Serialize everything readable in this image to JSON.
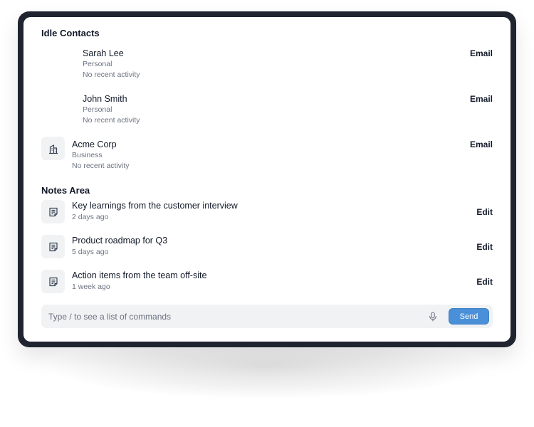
{
  "idle_contacts": {
    "title": "Idle Contacts",
    "items": [
      {
        "name": "Sarah Lee",
        "type": "Personal",
        "activity": "No recent activity",
        "action": "Email",
        "icon": ""
      },
      {
        "name": "John Smith",
        "type": "Personal",
        "activity": "No recent activity",
        "action": "Email",
        "icon": ""
      },
      {
        "name": "Acme Corp",
        "type": "Business",
        "activity": "No recent activity",
        "action": "Email",
        "icon": "building-icon"
      }
    ]
  },
  "notes_area": {
    "title": "Notes Area",
    "items": [
      {
        "title": "Key learnings from the customer interview",
        "time": "2 days ago",
        "action": "Edit",
        "icon": "note-icon"
      },
      {
        "title": "Product roadmap for Q3",
        "time": "5 days ago",
        "action": "Edit",
        "icon": "note-icon"
      },
      {
        "title": "Action items from the team off-site",
        "time": "1 week ago",
        "action": "Edit",
        "icon": "note-icon"
      }
    ]
  },
  "command_bar": {
    "placeholder": "Type / to see a list of commands",
    "mic_icon": "microphone-icon",
    "send_label": "Send"
  },
  "colors": {
    "frame": "#1f2430",
    "accent": "#4a90d9",
    "tile": "#f1f2f4",
    "muted_text": "#6b7280"
  }
}
